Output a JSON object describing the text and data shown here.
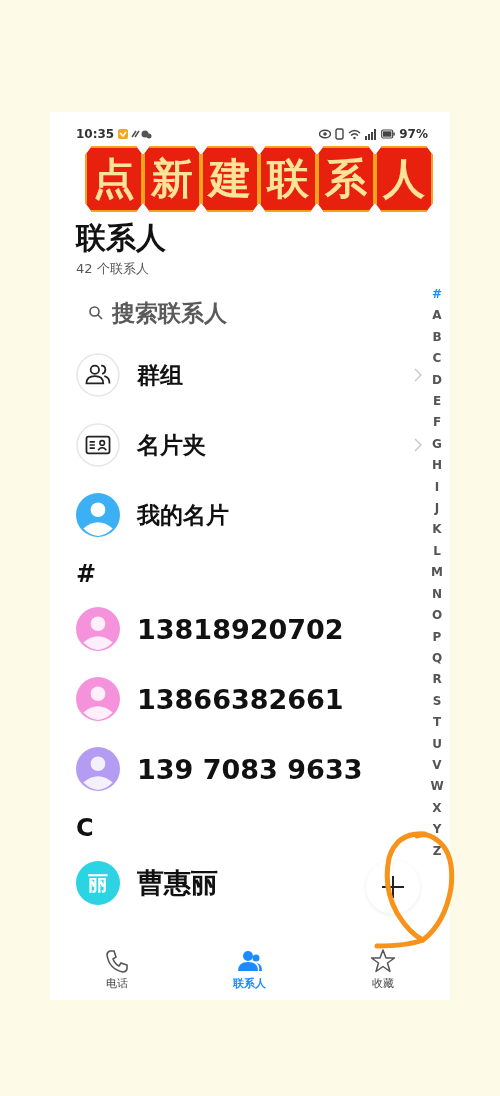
{
  "status_bar": {
    "time": "10:35",
    "battery": "97%"
  },
  "banner": [
    "点",
    "新",
    "建",
    "联",
    "系",
    "人"
  ],
  "header": {
    "title": "联系人",
    "count": "42 个联系人"
  },
  "search": {
    "placeholder": "搜索联系人"
  },
  "shortcuts": [
    {
      "label": "群组",
      "kind": "group",
      "chevron": true
    },
    {
      "label": "名片夹",
      "kind": "card",
      "chevron": true
    },
    {
      "label": "我的名片",
      "kind": "me",
      "chevron": false
    }
  ],
  "sections": [
    {
      "letter": "#",
      "contacts": [
        {
          "name": "13818920702",
          "color": "#f592dc"
        },
        {
          "name": "13866382661",
          "color": "#f592dc"
        },
        {
          "name": "139 7083 9633",
          "color": "#b49cf2"
        }
      ]
    },
    {
      "letter": "C",
      "contacts": [
        {
          "name": "曹惠丽",
          "initial": "丽",
          "color": "#2bd3e3"
        }
      ]
    }
  ],
  "index": [
    {
      "letter": "#",
      "selected": true
    },
    {
      "letter": "A",
      "selected": false
    },
    {
      "letter": "B",
      "selected": false
    },
    {
      "letter": "C",
      "selected": false
    },
    {
      "letter": "D",
      "selected": false
    },
    {
      "letter": "E",
      "selected": false
    },
    {
      "letter": "F",
      "selected": false
    },
    {
      "letter": "G",
      "selected": false
    },
    {
      "letter": "H",
      "selected": false
    },
    {
      "letter": "I",
      "selected": false
    },
    {
      "letter": "J",
      "selected": false
    },
    {
      "letter": "K",
      "selected": false
    },
    {
      "letter": "L",
      "selected": false
    },
    {
      "letter": "M",
      "selected": false
    },
    {
      "letter": "N",
      "selected": false
    },
    {
      "letter": "O",
      "selected": false
    },
    {
      "letter": "P",
      "selected": false
    },
    {
      "letter": "Q",
      "selected": false
    },
    {
      "letter": "R",
      "selected": false
    },
    {
      "letter": "S",
      "selected": false
    },
    {
      "letter": "T",
      "selected": false
    },
    {
      "letter": "U",
      "selected": false
    },
    {
      "letter": "V",
      "selected": false
    },
    {
      "letter": "W",
      "selected": false
    },
    {
      "letter": "X",
      "selected": false
    },
    {
      "letter": "Y",
      "selected": false
    },
    {
      "letter": "Z",
      "selected": false
    }
  ],
  "tabs": [
    {
      "label": "电话",
      "kind": "phone",
      "selected": false
    },
    {
      "label": "联系人",
      "kind": "people",
      "selected": true
    },
    {
      "label": "收藏",
      "kind": "star",
      "selected": false
    }
  ]
}
